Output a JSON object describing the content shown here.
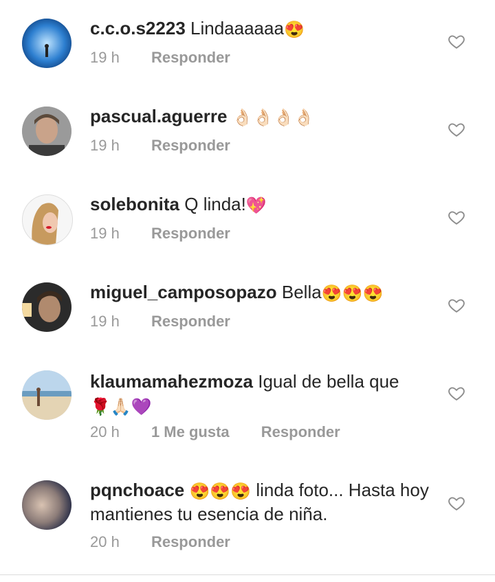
{
  "comments": [
    {
      "username": "c.c.o.s2223",
      "text": "Lindaaaaaa",
      "emoji": "😍",
      "time": "19 h",
      "likes": "",
      "reply": "Responder"
    },
    {
      "username": "pascual.aguerre",
      "text": "",
      "emoji": "👌🏻👌🏻👌🏻👌🏻",
      "time": "19 h",
      "likes": "",
      "reply": "Responder"
    },
    {
      "username": "solebonita",
      "text": "Q linda!",
      "emoji": "💖",
      "time": "19 h",
      "likes": "",
      "reply": "Responder"
    },
    {
      "username": "miguel_camposopazo",
      "text": "Bella",
      "emoji": "😍😍😍",
      "time": "19 h",
      "likes": "",
      "reply": "Responder"
    },
    {
      "username": "klaumamahezmoza",
      "text": "Igual de bella que",
      "emoji": "🌹🙏🏻💜",
      "time": "20 h",
      "likes": "1 Me gusta",
      "reply": "Responder"
    },
    {
      "username": "pqnchoace",
      "text_before": "😍😍😍",
      "text": "linda foto... Hasta hoy mantienes tu esencia de niña.",
      "time": "20 h",
      "likes": "",
      "reply": "Responder"
    }
  ],
  "icons": {
    "like": "heart-outline-icon"
  },
  "colors": {
    "text": "#262626",
    "meta": "#999999",
    "heart": "#8e8e8e"
  }
}
